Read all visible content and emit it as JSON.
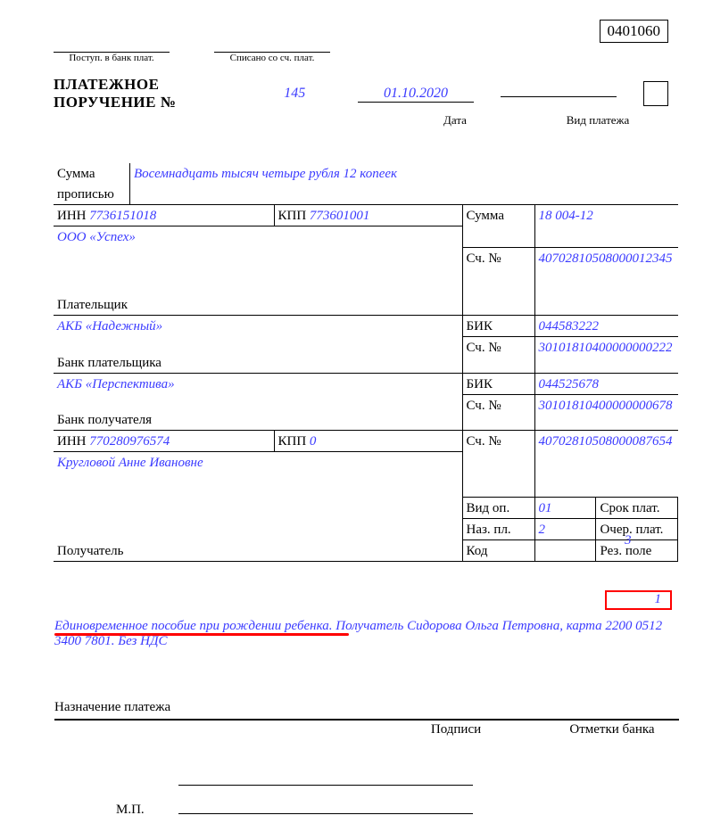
{
  "okud": "0401060",
  "top": {
    "received": "Поступ. в банк плат.",
    "debited": "Списано со сч. плат."
  },
  "title": "ПЛАТЕЖНОЕ ПОРУЧЕНИЕ №",
  "number": "145",
  "date": "01.10.2020",
  "sub": {
    "date": "Дата",
    "paytype": "Вид платежа"
  },
  "sum_words": {
    "label1": "Сумма",
    "label2": "прописью",
    "value": "Восемнадцать тысяч четыре рубля 12 копеек"
  },
  "payer": {
    "inn_label": "ИНН",
    "inn": "7736151018",
    "kpp_label": "КПП",
    "kpp": "773601001",
    "name": "ООО «Успех»",
    "label": "Плательщик"
  },
  "sum": {
    "label": "Сумма",
    "value": "18 004-12"
  },
  "payer_acct": {
    "label": "Сч. №",
    "value": "40702810508000012345"
  },
  "payer_bank": {
    "name": "АКБ «Надежный»",
    "label": "Банк плательщика",
    "bik_label": "БИК",
    "bik": "044583222",
    "acct_label": "Сч. №",
    "acct": "30101810400000000222"
  },
  "payee_bank": {
    "name": "АКБ «Перспектива»",
    "label": "Банк получателя",
    "bik_label": "БИК",
    "bik": "044525678",
    "acct_label": "Сч. №",
    "acct": "30101810400000000678"
  },
  "payee": {
    "inn_label": "ИНН",
    "inn": "770280976574",
    "kpp_label": "КПП",
    "kpp": "0",
    "acct_label": "Сч. №",
    "acct": "40702810508000087654",
    "name": "Кругловой Анне Ивановне",
    "label": "Получатель"
  },
  "extra": {
    "vid_op_label": "Вид оп.",
    "vid_op": "01",
    "srok_label": "Срок плат.",
    "naz_label": "Наз. пл.",
    "naz": "2",
    "ocher_label": "Очер. плат.",
    "ocher": "3",
    "kod_label": "Код",
    "rez_label": "Рез. поле"
  },
  "red_number": "1",
  "description": "Единовременное пособие при рождении ребенка. Получатель Сидорова Ольга Петровна, карта 2200 0512 3400 7801. Без НДС",
  "nazn_label": "Назначение платежа",
  "signatures": {
    "sign": "Подписи",
    "bank": "Отметки банка",
    "mp": "М.П."
  }
}
